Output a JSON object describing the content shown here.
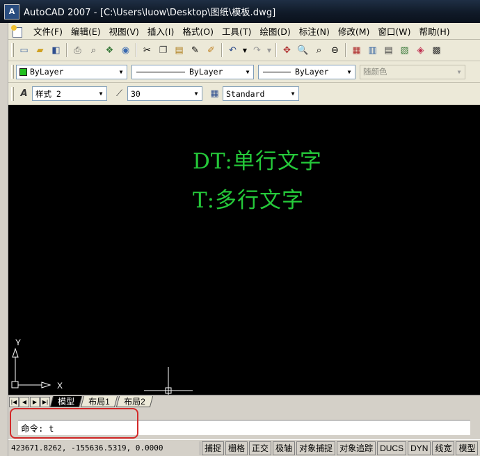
{
  "window": {
    "app_icon": "A",
    "title": "AutoCAD 2007 - [C:\\Users\\luow\\Desktop\\图纸\\模板.dwg]"
  },
  "menu": [
    "文件(F)",
    "编辑(E)",
    "视图(V)",
    "插入(I)",
    "格式(O)",
    "工具(T)",
    "绘图(D)",
    "标注(N)",
    "修改(M)",
    "窗口(W)",
    "帮助(H)"
  ],
  "properties": {
    "color": "ByLayer",
    "linetype": "ByLayer",
    "lineweight": "ByLayer",
    "plotstyle": "随颜色",
    "color_swatch": "#21c021"
  },
  "styles": {
    "text_style": "样式 2",
    "dim_scale": "30",
    "table_style": "Standard"
  },
  "drawing": {
    "line1": "DT:单行文字",
    "line2": "T:多行文字",
    "ucs_x": "X",
    "ucs_y": "Y",
    "text_color": "#25c93a"
  },
  "tabs": [
    "模型",
    "布局1",
    "布局2"
  ],
  "command": {
    "prompt": "命令: t"
  },
  "status": {
    "coords": "423671.8262, -155636.5319, 0.0000",
    "buttons": [
      "捕捉",
      "栅格",
      "正交",
      "极轴",
      "对象捕捉",
      "对象追踪",
      "DUCS",
      "DYN",
      "线宽",
      "模型"
    ]
  }
}
